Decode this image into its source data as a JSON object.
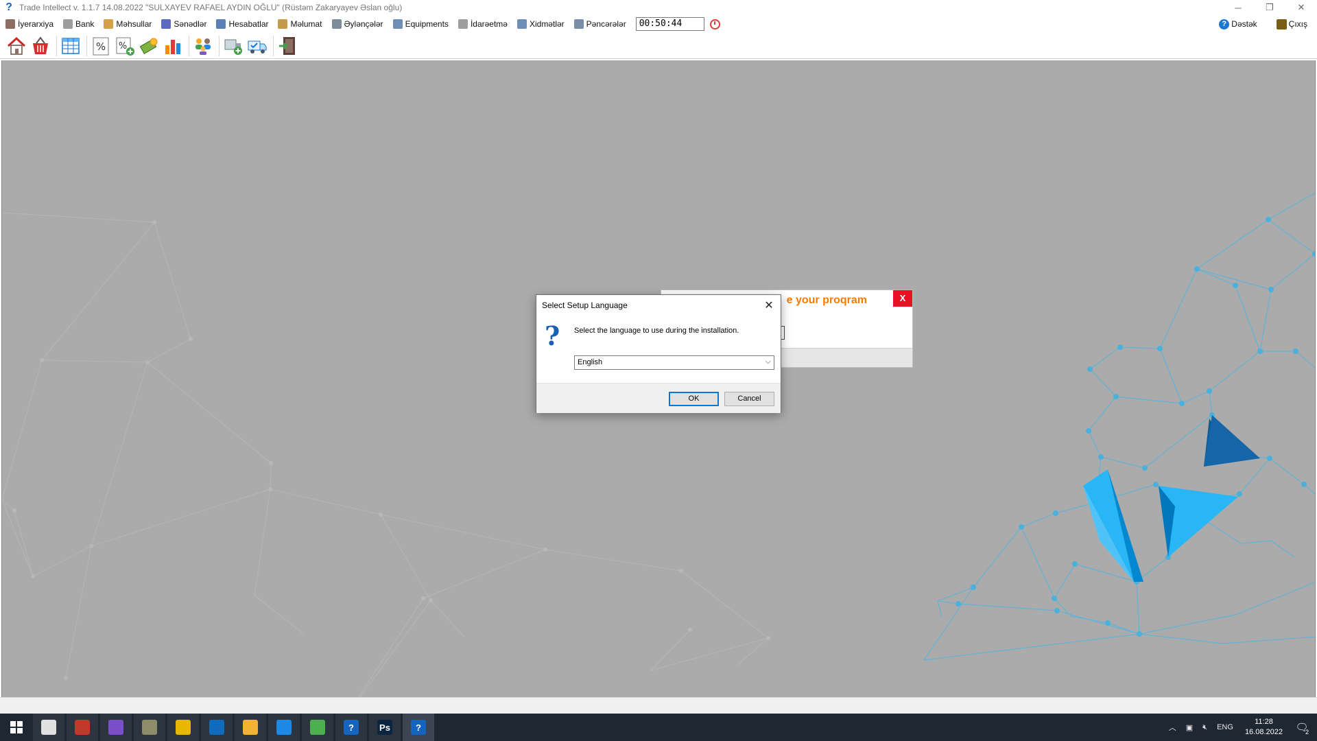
{
  "window": {
    "title": "Trade Intellect v. 1.1.7 14.08.2022 \"SULXAYEV RAFAEL AYDIN OĞLU\"  (Rüstəm Zakaryayev Əslan oğlu)",
    "controls": {
      "minimize": "─",
      "restore": "❐",
      "close": "✕"
    }
  },
  "menu": {
    "items": [
      {
        "label": "İyerarxiya",
        "icon": "hierarchy-icon",
        "color": "#8d6e63"
      },
      {
        "label": "Bank",
        "icon": "bank-icon",
        "color": "#9e9e9e"
      },
      {
        "label": "Məhsullar",
        "icon": "products-box-icon",
        "color": "#d4a04a"
      },
      {
        "label": "Sənədlər",
        "icon": "documents-icon",
        "color": "#5c6bc0"
      },
      {
        "label": "Hesabatlar",
        "icon": "reports-icon",
        "color": "#5c7fb5"
      },
      {
        "label": "Məlumat",
        "icon": "info-book-icon",
        "color": "#c49b4a"
      },
      {
        "label": "Əylənçələr",
        "icon": "entertainment-icon",
        "color": "#7e8c9a"
      },
      {
        "label": "Equipments",
        "icon": "equipment-icon",
        "color": "#6d8fb5"
      },
      {
        "label": "İdarəetmə",
        "icon": "management-icon",
        "color": "#9e9e9e"
      },
      {
        "label": "Xidmətlər",
        "icon": "services-icon",
        "color": "#6d8fb5"
      },
      {
        "label": "Pəncərələr",
        "icon": "windows-icon",
        "color": "#7a8ea8"
      }
    ],
    "timer": "00:50:44",
    "right": {
      "support": "Dəstək",
      "exit": "Çıxış"
    }
  },
  "toolbar": {
    "buttons": [
      "home-icon",
      "basket-icon",
      "spreadsheet-icon",
      "percent-icon",
      "percent-add-icon",
      "payment-icon",
      "bar-chart-icon",
      "users-icon",
      "add-shipment-icon",
      "delivery-truck-icon",
      "exit-door-icon"
    ]
  },
  "back_popup": {
    "title_partial": "e your proqram",
    "close": "X"
  },
  "dialog": {
    "title": "Select Setup Language",
    "close": "✕",
    "message": "Select the language to use during the installation.",
    "selected_language": "English",
    "ok": "OK",
    "cancel": "Cancel"
  },
  "taskbar": {
    "apps": [
      {
        "name": "chrome",
        "glyph": "",
        "color": "#e0e0e0",
        "active": false
      },
      {
        "name": "tool-app",
        "glyph": "",
        "color": "#c0392b",
        "active": false
      },
      {
        "name": "visual-studio",
        "glyph": "",
        "color": "#7b4fc9",
        "active": false
      },
      {
        "name": "archive-app",
        "glyph": "",
        "color": "#8d8d6a",
        "active": false
      },
      {
        "name": "dotnet-app",
        "glyph": "",
        "color": "#e6b800",
        "active": false
      },
      {
        "name": "outlook",
        "glyph": "",
        "color": "#0f6cbd",
        "active": false
      },
      {
        "name": "file-explorer",
        "glyph": "",
        "color": "#f2b233",
        "active": false
      },
      {
        "name": "vscode",
        "glyph": "",
        "color": "#1e88e5",
        "active": false
      },
      {
        "name": "notepad",
        "glyph": "",
        "color": "#4caf50",
        "active": false
      },
      {
        "name": "setup-help",
        "glyph": "?",
        "color": "#1565c0",
        "active": false
      },
      {
        "name": "photoshop",
        "glyph": "Ps",
        "color": "#0b2540",
        "active": false
      },
      {
        "name": "setup-help-active",
        "glyph": "?",
        "color": "#1565c0",
        "active": true
      }
    ],
    "tray": {
      "language": "ENG",
      "time": "11:28",
      "date": "16.08.2022",
      "notifications": "2"
    }
  }
}
